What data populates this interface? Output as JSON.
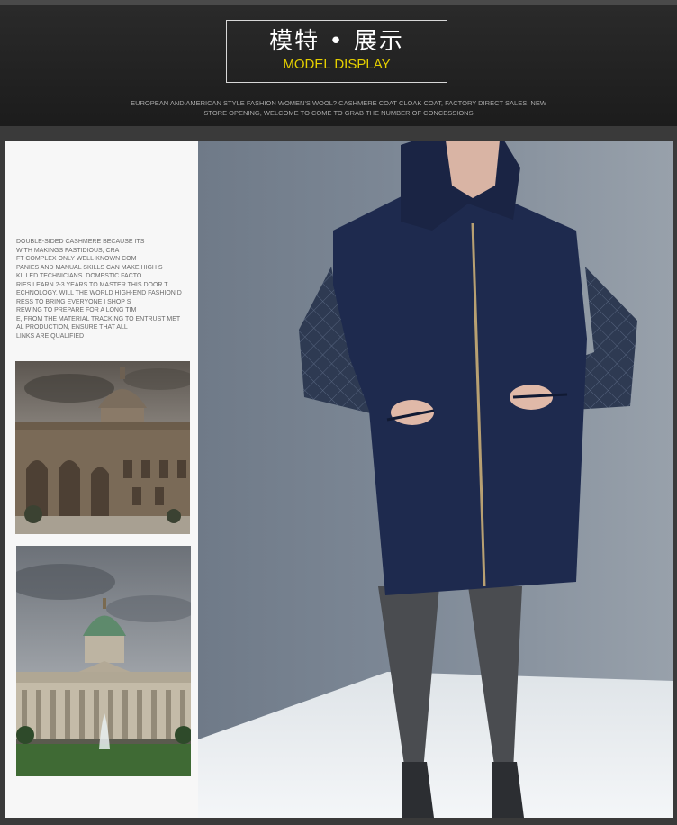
{
  "header": {
    "title_cn": "模特 • 展示",
    "title_en": "MODEL DISPLAY",
    "tagline": "EUROPEAN AND AMERICAN STYLE FASHION WOMEN'S WOOL? CASHMERE COAT CLOAK COAT, FACTORY DIRECT SALES, NEW STORE OPENING, WELCOME TO COME TO GRAB THE NUMBER OF CONCESSIONS"
  },
  "description": {
    "lines": [
      "DOUBLE-SIDED CASHMERE BECAUSE ITS",
      "WITH MAKINGS FASTIDIOUS, CRA",
      "FT COMPLEX ONLY WELL-KNOWN COM",
      "PANIES AND MANUAL SKILLS CAN MAKE HIGH S",
      "KILLED TECHNICIANS. DOMESTIC FACTO",
      "RIES LEARN 2-3 YEARS TO MASTER THIS DOOR T",
      "ECHNOLOGY, WILL THE WORLD HIGH-END FASHION D",
      "RESS TO BRING EVERYONE I SHOP S",
      "REWING TO PREPARE FOR A LONG TIM",
      "E, FROM THE MATERIAL TRACKING TO ENTRUST MET",
      "AL PRODUCTION, ENSURE THAT ALL",
      " LINKS ARE QUALIFIED"
    ]
  },
  "colors": {
    "accent": "#e6d000",
    "coat": "#1e2a4e",
    "background": "#3a3a3a"
  }
}
